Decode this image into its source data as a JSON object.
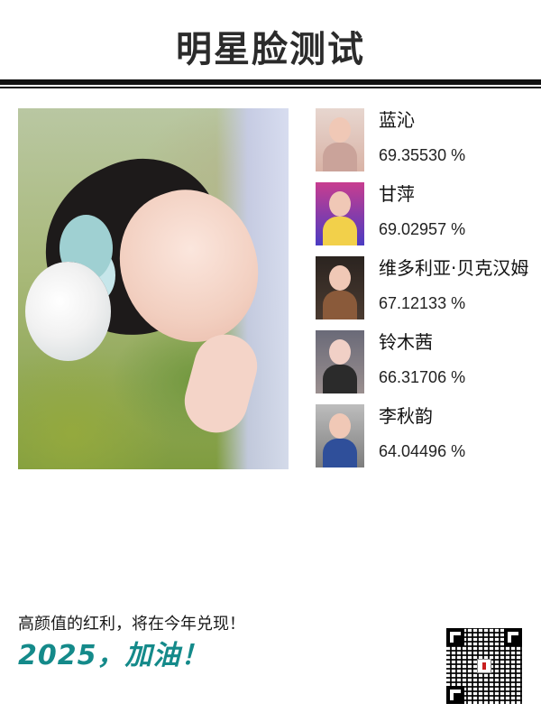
{
  "header": {
    "title": "明星脸测试"
  },
  "main_photo": {
    "kind": "portrait-photo"
  },
  "matches": [
    {
      "name": "蓝沁",
      "score": "69.35530 %",
      "thumb_color": "#d9b3a6"
    },
    {
      "name": "甘萍",
      "score": "69.02957 %",
      "thumb_color": "#e04a9a"
    },
    {
      "name": "维多利亚·贝克汉姆",
      "score": "67.12133 %",
      "thumb_color": "#3a2a22"
    },
    {
      "name": "铃木茜",
      "score": "66.31706 %",
      "thumb_color": "#6b6b7a"
    },
    {
      "name": "李秋韵",
      "score": "64.04496 %",
      "thumb_color": "#2f4f9a"
    }
  ],
  "footer": {
    "line1": "高颜值的红利，将在今年兑现！",
    "line2": "2025，加油！",
    "qr_icon": "qr-code-icon"
  },
  "colors": {
    "accent_teal": "#148a8a",
    "rule": "#111111"
  }
}
